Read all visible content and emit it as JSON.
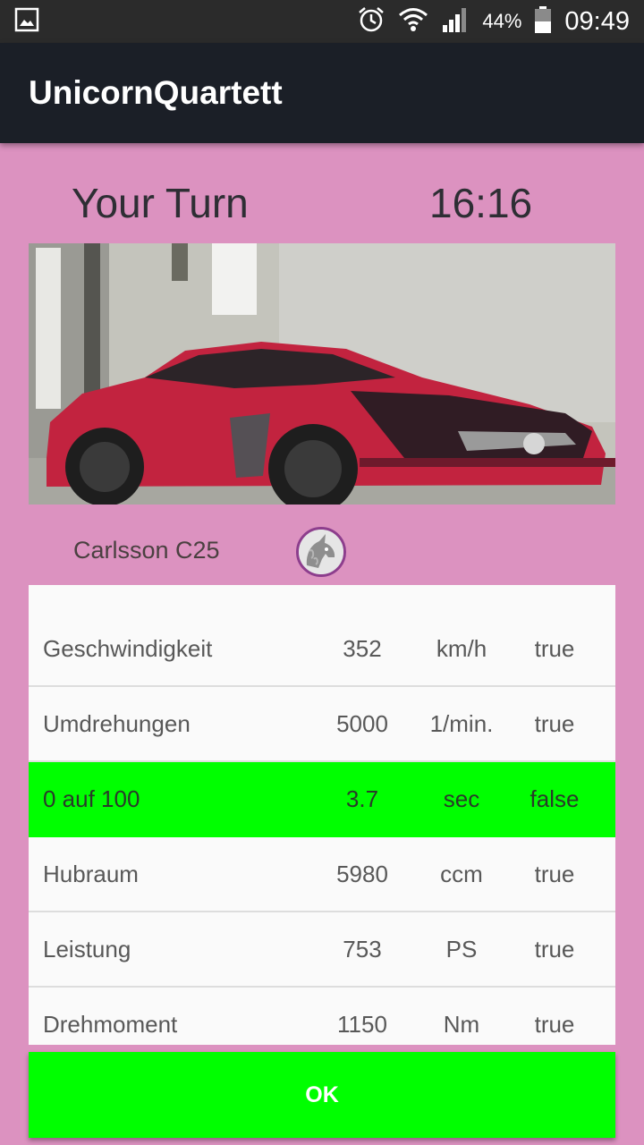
{
  "status_bar": {
    "battery": "44%",
    "time": "09:49",
    "icons": [
      "gallery-icon",
      "alarm-icon",
      "wifi-icon",
      "signal-icon",
      "battery-icon"
    ]
  },
  "app": {
    "title": "UnicornQuartett"
  },
  "game": {
    "turn_label": "Your Turn",
    "timer": "16:16"
  },
  "card": {
    "name": "Carlsson C25",
    "badge_icon": "unicorn-icon",
    "stats": [
      {
        "name": "Geschwindigkeit",
        "value": "352",
        "unit": "km/h",
        "flag": "true"
      },
      {
        "name": "Umdrehungen",
        "value": "5000",
        "unit": "1/min.",
        "flag": "true"
      },
      {
        "name": "0 auf 100",
        "value": "3.7",
        "unit": "sec",
        "flag": "false",
        "selected": true
      },
      {
        "name": "Hubraum",
        "value": "5980",
        "unit": "ccm",
        "flag": "true"
      },
      {
        "name": "Leistung",
        "value": "753",
        "unit": "PS",
        "flag": "true"
      },
      {
        "name": "Drehmoment",
        "value": "1150",
        "unit": "Nm",
        "flag": "true"
      }
    ]
  },
  "ok_button": {
    "label": "OK"
  },
  "colors": {
    "background": "#dc92c0",
    "app_bar": "#1b1f27",
    "status_bar": "#2b2b2b",
    "highlight": "#00ff00",
    "badge_border": "#8d3e8d"
  }
}
